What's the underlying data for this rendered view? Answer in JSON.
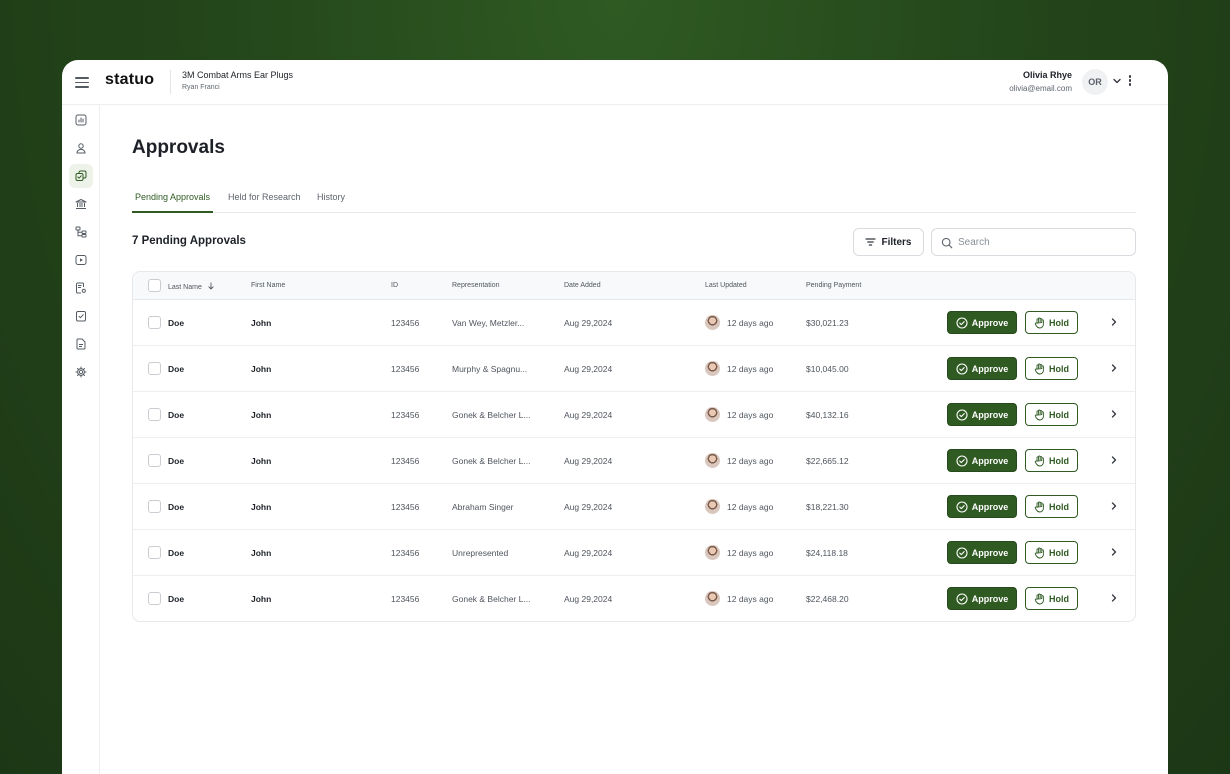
{
  "app": {
    "logo": "statuo",
    "case_title": "3M Combat Arms Ear Plugs",
    "case_subtitle": "Ryan Franci"
  },
  "user": {
    "name": "Olivia Rhye",
    "email": "olivia@email.com",
    "initials": "OR"
  },
  "sidebar": {
    "items": [
      {
        "icon": "chart-icon",
        "active": false
      },
      {
        "icon": "user-icon",
        "active": false
      },
      {
        "icon": "approvals-icon",
        "active": true
      },
      {
        "icon": "bank-icon",
        "active": false
      },
      {
        "icon": "hierarchy-icon",
        "active": false
      },
      {
        "icon": "play-icon",
        "active": false
      },
      {
        "icon": "document-settings-icon",
        "active": false
      },
      {
        "icon": "task-check-icon",
        "active": false
      },
      {
        "icon": "file-icon",
        "active": false
      },
      {
        "icon": "gear-icon",
        "active": false
      }
    ]
  },
  "page": {
    "title": "Approvals",
    "tabs": [
      {
        "label": "Pending Approvals",
        "active": true
      },
      {
        "label": "Held for Research",
        "active": false
      },
      {
        "label": "History",
        "active": false
      }
    ],
    "count_title": "7 Pending Approvals",
    "filters_label": "Filters",
    "search_placeholder": "Search"
  },
  "table": {
    "columns": [
      "Last Name",
      "First Name",
      "ID",
      "Representation",
      "Date Added",
      "Last Updated",
      "Pending Payment"
    ],
    "sort_column": "Last Name",
    "approve_label": "Approve",
    "hold_label": "Hold",
    "rows": [
      {
        "last_name": "Doe",
        "first_name": "John",
        "id": "123456",
        "representation": "Van Wey, Metzler...",
        "date_added": "Aug 29,2024",
        "last_updated": "12 days ago",
        "pending_payment": "$30,021.23"
      },
      {
        "last_name": "Doe",
        "first_name": "John",
        "id": "123456",
        "representation": "Murphy & Spagnu...",
        "date_added": "Aug 29,2024",
        "last_updated": "12 days ago",
        "pending_payment": "$10,045.00"
      },
      {
        "last_name": "Doe",
        "first_name": "John",
        "id": "123456",
        "representation": "Gonek & Belcher L...",
        "date_added": "Aug 29,2024",
        "last_updated": "12 days ago",
        "pending_payment": "$40,132.16"
      },
      {
        "last_name": "Doe",
        "first_name": "John",
        "id": "123456",
        "representation": "Gonek & Belcher L...",
        "date_added": "Aug 29,2024",
        "last_updated": "12 days ago",
        "pending_payment": "$22,665.12"
      },
      {
        "last_name": "Doe",
        "first_name": "John",
        "id": "123456",
        "representation": "Abraham Singer",
        "date_added": "Aug 29,2024",
        "last_updated": "12 days ago",
        "pending_payment": "$18,221.30"
      },
      {
        "last_name": "Doe",
        "first_name": "John",
        "id": "123456",
        "representation": "Unrepresented",
        "date_added": "Aug 29,2024",
        "last_updated": "12 days ago",
        "pending_payment": "$24,118.18"
      },
      {
        "last_name": "Doe",
        "first_name": "John",
        "id": "123456",
        "representation": "Gonek & Belcher L...",
        "date_added": "Aug 29,2024",
        "last_updated": "12 days ago",
        "pending_payment": "$22,468.20"
      }
    ]
  },
  "colors": {
    "brand_green": "#2f5a22",
    "background_green": "#24461b"
  }
}
